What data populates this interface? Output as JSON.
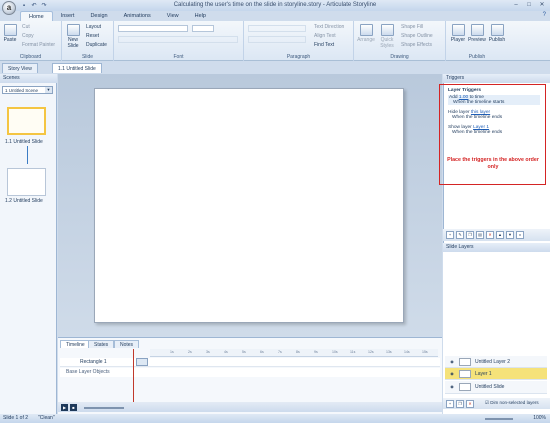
{
  "app": {
    "orb_letter": "a",
    "window_title": "Calculating the user's time on the slide in storyline.story - Articulate Storyline"
  },
  "ribbon": {
    "tabs": [
      "Home",
      "Insert",
      "Design",
      "Animations",
      "View",
      "Help"
    ],
    "active_tab": "Home",
    "clipboard": {
      "paste": "Paste",
      "cut": "Cut",
      "copy": "Copy",
      "format_painter": "Format Painter",
      "label": "Clipboard"
    },
    "slide": {
      "new_slide": "New Slide",
      "layout": "Layout",
      "reset": "Reset",
      "duplicate": "Duplicate",
      "label": "Slide"
    },
    "font_label": "Font",
    "paragraph": {
      "text_direction": "Text Direction",
      "align_text": "Align Text",
      "find_text": "Find Text",
      "label": "Paragraph"
    },
    "drawing": {
      "arrange": "Arrange",
      "quick_styles": "Quick Styles",
      "shape_fill": "Shape Fill",
      "shape_outline": "Shape Outline",
      "shape_effects": "Shape Effects",
      "label": "Drawing"
    },
    "publish": {
      "player": "Player",
      "preview": "Preview",
      "publish": "Publish",
      "label": "Publish"
    }
  },
  "doc_tabs": [
    "Story View",
    "1.1 Untitled Slide"
  ],
  "scenes": {
    "header": "Scenes",
    "selected_scene": "1 Untitled Scene",
    "slides": [
      {
        "label": "1.1 Untitled Slide"
      },
      {
        "label": "1.2 Untitled Slide"
      }
    ]
  },
  "timeline": {
    "tabs": [
      "Timeline",
      "States",
      "Notes"
    ],
    "ticks": [
      "1s",
      "2s",
      "3s",
      "4s",
      "5s",
      "6s",
      "7s",
      "8s",
      "9s",
      "10s",
      "11s",
      "12s",
      "13s",
      "14s",
      "15s"
    ],
    "rows": [
      "Rectangle 1",
      "Base Layer Objects"
    ]
  },
  "triggers": {
    "header": "Triggers",
    "group_title": "Layer Triggers",
    "items": [
      {
        "line1_prefix": "Add",
        "line1_link": "1.00",
        "line1_suffix": "to time",
        "line2": "When the timeline starts"
      },
      {
        "line1_prefix": "Hide layer",
        "line1_link": "this layer",
        "line1_suffix": "",
        "line2": "When the timeline ends"
      },
      {
        "line1_prefix": "Show layer",
        "line1_link": "Layer 1",
        "line1_suffix": "",
        "line2": "When the timeline ends"
      }
    ],
    "annotation": "Place the triggers in the above order only"
  },
  "slide_layers": {
    "header": "Slide Layers",
    "layers": [
      {
        "name": "Untitled Layer 2",
        "selected": false
      },
      {
        "name": "Layer 1",
        "selected": true
      },
      {
        "name": "Untitled Slide",
        "selected": false
      }
    ],
    "dim_label": "Dim non-selected layers"
  },
  "status": {
    "slide_info": "Slide 1 of 2",
    "theme": "\"Clean\"",
    "zoom": "100%"
  },
  "colors": {
    "annotation_red": "#d42424",
    "selected_layer": "#f5e27a",
    "ribbon_blue": "#1e395b"
  }
}
